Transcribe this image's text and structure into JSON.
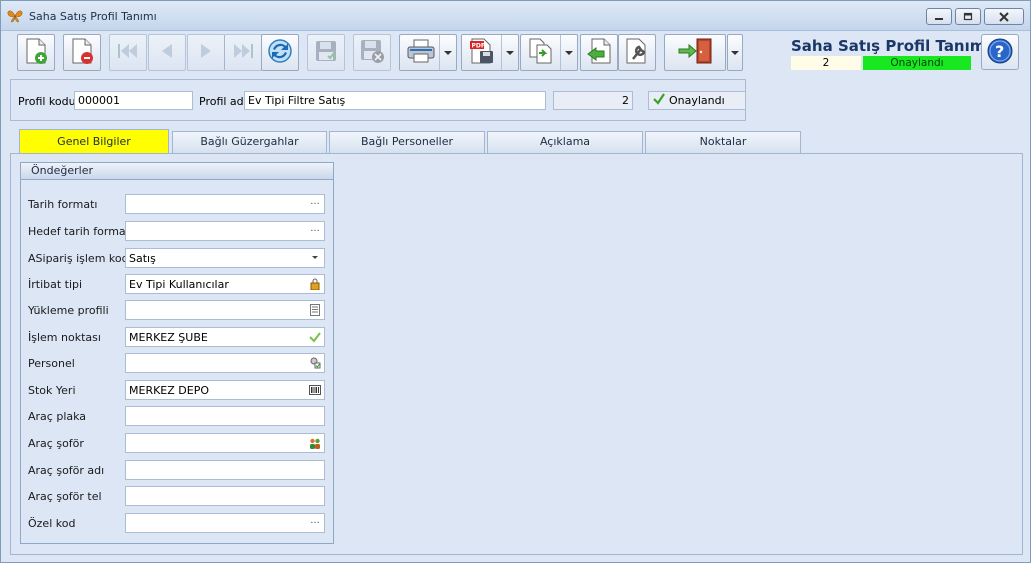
{
  "window": {
    "title": "Saha Satış Profil Tanımı"
  },
  "header": {
    "title": "Saha Satış Profil Tanımı",
    "number": "2",
    "status": "Onaylandı",
    "status_color": "#17e81f"
  },
  "toolbar": {
    "buttons": [
      {
        "name": "new-document-icon"
      },
      {
        "name": "delete-document-icon"
      },
      {
        "name": "first-record-icon"
      },
      {
        "name": "previous-record-icon"
      },
      {
        "name": "next-record-icon"
      },
      {
        "name": "last-record-icon"
      },
      {
        "name": "refresh-icon"
      },
      {
        "name": "save-icon"
      },
      {
        "name": "save-close-icon"
      },
      {
        "name": "print-icon"
      },
      {
        "name": "pdf-export-icon"
      },
      {
        "name": "copy-document-icon"
      },
      {
        "name": "import-icon"
      },
      {
        "name": "settings-icon"
      },
      {
        "name": "exit-icon"
      }
    ]
  },
  "profile": {
    "code_label": "Profil kodu",
    "code_value": "000001",
    "name_label": "Profil adı",
    "name_value": "Ev Tipi Filtre Satış",
    "number": "2",
    "status": "Onaylandı"
  },
  "tabs": [
    {
      "label": "Genel Bilgiler",
      "active": true
    },
    {
      "label": "Bağlı Güzergahlar"
    },
    {
      "label": "Bağlı Personeller"
    },
    {
      "label": "Açıklama"
    },
    {
      "label": "Noktalar"
    }
  ],
  "group": {
    "title": "Öndeğerler",
    "fields": [
      {
        "label": "Tarih formatı",
        "value": "",
        "button": "ellipsis"
      },
      {
        "label": "Hedef tarih formatı",
        "value": "",
        "button": "ellipsis"
      },
      {
        "label": "ASipariş işlem kodu",
        "value": "Satış",
        "button": "dropdown"
      },
      {
        "label": "İrtibat tipi",
        "value": "Ev Tipi Kullanıcılar",
        "button": "lock"
      },
      {
        "label": "Yükleme profili",
        "value": "",
        "button": "list"
      },
      {
        "label": "İşlem noktası",
        "value": "MERKEZ ŞUBE",
        "button": "check"
      },
      {
        "label": "Personel",
        "value": "",
        "button": "person"
      },
      {
        "label": "Stok Yeri",
        "value": "MERKEZ DEPO",
        "button": "barcode"
      },
      {
        "label": "Araç plaka",
        "value": "",
        "button": ""
      },
      {
        "label": "Araç şoför",
        "value": "",
        "button": "people"
      },
      {
        "label": "Araç şoför adı",
        "value": "",
        "button": ""
      },
      {
        "label": "Araç şoför tel",
        "value": "",
        "button": ""
      },
      {
        "label": "Özel kod",
        "value": "",
        "button": "ellipsis"
      }
    ]
  }
}
